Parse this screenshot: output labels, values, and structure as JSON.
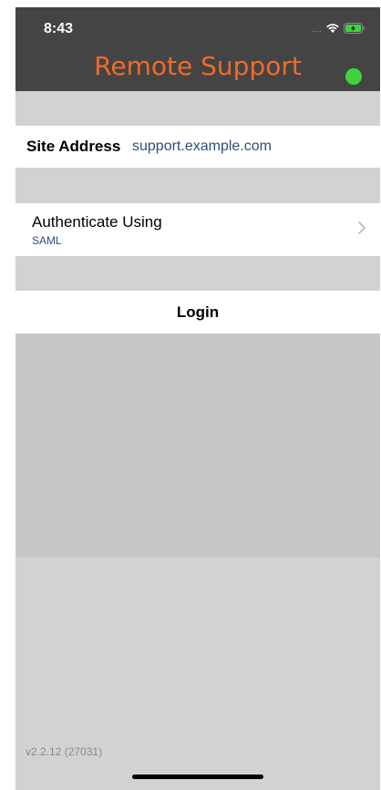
{
  "status_bar": {
    "time": "8:43",
    "signal": "....",
    "wifi_icon": "wifi-icon",
    "battery_icon": "battery-charging-icon",
    "battery_color": "#3fd43f"
  },
  "nav": {
    "title": "Remote Support",
    "title_color": "#f06b2a",
    "status_dot_color": "#3fd43f"
  },
  "form": {
    "site_address_label": "Site Address",
    "site_address_value": "support.example.com",
    "auth_label": "Authenticate Using",
    "auth_value": "SAML",
    "login_label": "Login"
  },
  "footer": {
    "version": "v2.2.12 (27031)"
  }
}
